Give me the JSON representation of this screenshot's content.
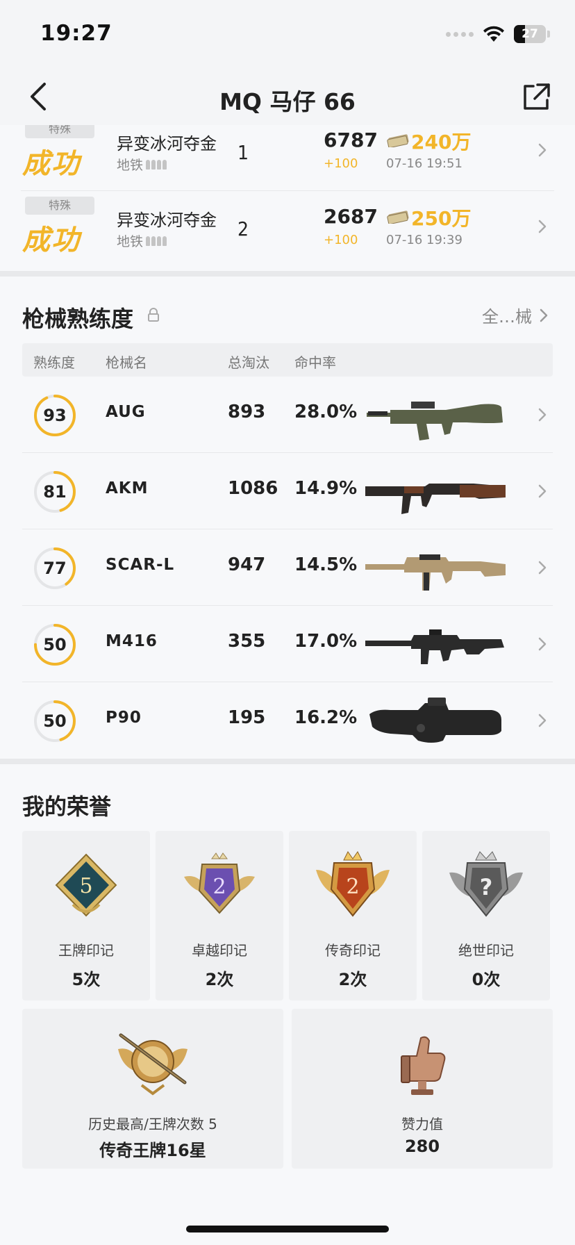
{
  "status_bar": {
    "time": "19:27",
    "battery": "27"
  },
  "header": {
    "title": "MQ 马仔 66"
  },
  "matches": [
    {
      "mode_tag": "特殊",
      "result": "成功",
      "map": "异变冰河夺金",
      "sub": "地铁",
      "rank": "1",
      "score": "6787",
      "score_delta": "+100",
      "money": "240万",
      "time": "07-16 19:51"
    },
    {
      "mode_tag": "特殊",
      "result": "成功",
      "map": "异变冰河夺金",
      "sub": "地铁",
      "rank": "2",
      "score": "2687",
      "score_delta": "+100",
      "money": "250万",
      "time": "07-16 19:39"
    }
  ],
  "weapons": {
    "title": "枪械熟练度",
    "see_all": "全…械",
    "columns": {
      "proficiency": "熟练度",
      "name": "枪械名",
      "kills": "总淘汰",
      "hit_rate": "命中率"
    },
    "rows": [
      {
        "proficiency": "93",
        "level": 0.93,
        "name": "AUG",
        "kills": "893",
        "hit_rate": "28.0%",
        "icon": "aug-rifle"
      },
      {
        "proficiency": "81",
        "level": 0.45,
        "name": "AKM",
        "kills": "1086",
        "hit_rate": "14.9%",
        "icon": "akm-rifle"
      },
      {
        "proficiency": "77",
        "level": 0.4,
        "name": "SCAR-L",
        "kills": "947",
        "hit_rate": "14.5%",
        "icon": "scar-l-rifle"
      },
      {
        "proficiency": "50",
        "level": 0.75,
        "name": "M416",
        "kills": "355",
        "hit_rate": "17.0%",
        "icon": "m416-rifle"
      },
      {
        "proficiency": "50",
        "level": 0.45,
        "name": "P90",
        "kills": "195",
        "hit_rate": "16.2%",
        "icon": "p90-smg"
      }
    ]
  },
  "honors": {
    "title": "我的荣誉",
    "badges": [
      {
        "name": "王牌印记",
        "count": "5次",
        "icon": "ace-mark-badge",
        "number": "5"
      },
      {
        "name": "卓越印记",
        "count": "2次",
        "icon": "excellence-mark-badge",
        "number": "2"
      },
      {
        "name": "传奇印记",
        "count": "2次",
        "icon": "legend-mark-badge",
        "number": "2"
      },
      {
        "name": "绝世印记",
        "count": "0次",
        "icon": "peerless-mark-badge",
        "number": "?"
      }
    ],
    "highest": {
      "label": "历史最高/王牌次数 5",
      "value": "传奇王牌16星",
      "icon": "legend-ace-emblem"
    },
    "likes": {
      "label": "赞力值",
      "value": "280",
      "icon": "thumbs-up-trophy"
    }
  },
  "colors": {
    "accent": "#f2b529",
    "background": "#f4f5f7"
  }
}
